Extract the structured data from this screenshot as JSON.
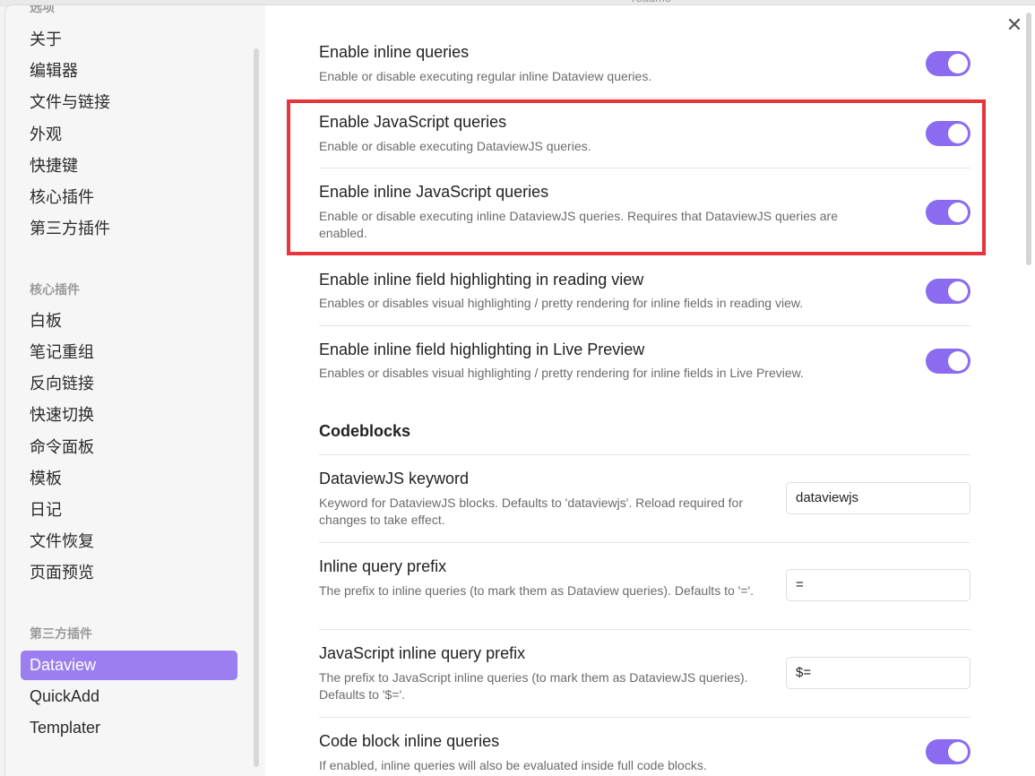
{
  "background": {
    "cut_title": "readme"
  },
  "sidebar": {
    "cut_heading": "选项",
    "options": [
      "关于",
      "编辑器",
      "文件与链接",
      "外观",
      "快捷键",
      "核心插件",
      "第三方插件"
    ],
    "core_heading": "核心插件",
    "core_plugins": [
      "白板",
      "笔记重组",
      "反向链接",
      "快速切换",
      "命令面板",
      "模板",
      "日记",
      "文件恢复",
      "页面预览"
    ],
    "third_heading": "第三方插件",
    "third_plugins": [
      "Dataview",
      "QuickAdd",
      "Templater"
    ],
    "active_plugin": "Dataview"
  },
  "content": {
    "close_icon": "close-icon",
    "settings": [
      {
        "title": "Enable inline queries",
        "desc": "Enable or disable executing regular inline Dataview queries.",
        "enabled": true
      },
      {
        "title": "Enable JavaScript queries",
        "desc": "Enable or disable executing DataviewJS queries.",
        "enabled": true
      },
      {
        "title": "Enable inline JavaScript queries",
        "desc": "Enable or disable executing inline DataviewJS queries. Requires that DataviewJS queries are enabled.",
        "enabled": true
      },
      {
        "title": "Enable inline field highlighting in reading view",
        "desc": "Enables or disables visual highlighting / pretty rendering for inline fields in reading view.",
        "enabled": true
      },
      {
        "title": "Enable inline field highlighting in Live Preview",
        "desc": "Enables or disables visual highlighting / pretty rendering for inline fields in Live Preview.",
        "enabled": true
      }
    ],
    "codeblocks_heading": "Codeblocks",
    "codeblock_settings": [
      {
        "title": "DataviewJS keyword",
        "desc": "Keyword for DataviewJS blocks. Defaults to 'dataviewjs'. Reload required for changes to take effect.",
        "value": "dataviewjs"
      },
      {
        "title": "Inline query prefix",
        "desc": "The prefix to inline queries (to mark them as Dataview queries). Defaults to '='.",
        "value": "="
      },
      {
        "title": "JavaScript inline query prefix",
        "desc": "The prefix to JavaScript inline queries (to mark them as DataviewJS queries). Defaults to '$='.",
        "value": "$="
      }
    ],
    "code_block_inline": {
      "title": "Code block inline queries",
      "desc": "If enabled, inline queries will also be evaluated inside full code blocks.",
      "enabled": true
    }
  },
  "colors": {
    "accent": "#8b6cf0",
    "highlight": "#e8343c",
    "active_item": "#9b7ff0"
  }
}
